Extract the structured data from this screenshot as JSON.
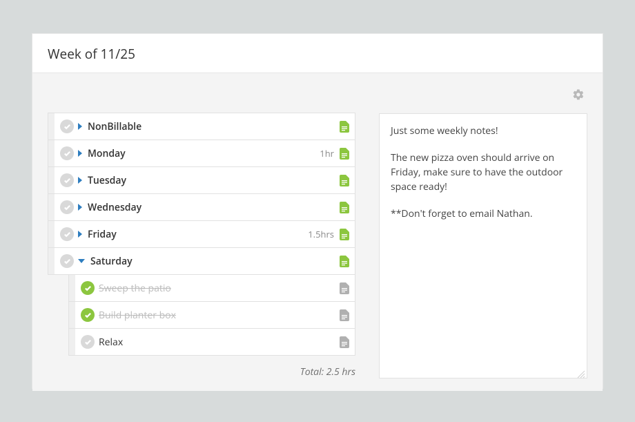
{
  "header": {
    "title": "Week of 11/25"
  },
  "days": [
    {
      "label": "NonBillable",
      "expanded": false,
      "hasNote": true,
      "noteColor": "green",
      "time": ""
    },
    {
      "label": "Monday",
      "expanded": false,
      "hasNote": true,
      "noteColor": "green",
      "time": "1hr"
    },
    {
      "label": "Tuesday",
      "expanded": false,
      "hasNote": true,
      "noteColor": "green",
      "time": ""
    },
    {
      "label": "Wednesday",
      "expanded": false,
      "hasNote": true,
      "noteColor": "green",
      "time": ""
    },
    {
      "label": "Friday",
      "expanded": false,
      "hasNote": true,
      "noteColor": "green",
      "time": "1.5hrs"
    },
    {
      "label": "Saturday",
      "expanded": true,
      "hasNote": true,
      "noteColor": "green",
      "time": "",
      "tasks": [
        {
          "label": "Sweep the patio",
          "completed": true
        },
        {
          "label": "Build planter box",
          "completed": true
        },
        {
          "label": "Relax",
          "completed": false
        }
      ]
    }
  ],
  "total": {
    "label": "Total: 2.5 hrs"
  },
  "notes": {
    "p1": "Just some weekly notes!",
    "p2": "The new pizza oven should arrive on Friday, make sure to have the outdoor space ready!",
    "p3": "**Don't forget to email Nathan."
  }
}
